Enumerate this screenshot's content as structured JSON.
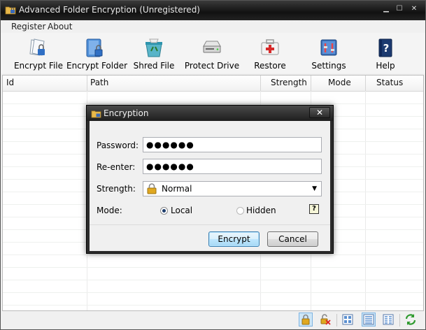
{
  "window": {
    "title": "Advanced Folder Encryption (Unregistered)",
    "controls": [
      "minimize-icon",
      "maximize-icon",
      "close-icon"
    ]
  },
  "menu": {
    "items": [
      {
        "label": "Register"
      },
      {
        "label": "About"
      }
    ]
  },
  "toolbar": {
    "items": [
      {
        "label": "Encrypt File",
        "icon": "encrypt-file-icon"
      },
      {
        "label": "Encrypt Folder",
        "icon": "encrypt-folder-icon"
      },
      {
        "label": "Shred File",
        "icon": "shred-icon"
      },
      {
        "label": "Protect Drive",
        "icon": "drive-icon"
      },
      {
        "label": "Restore",
        "icon": "restore-icon"
      },
      {
        "label": "Settings",
        "icon": "settings-icon"
      },
      {
        "label": "Help",
        "icon": "help-book-icon"
      }
    ]
  },
  "table": {
    "columns": [
      "Id",
      "Path",
      "Strength",
      "Mode",
      "Status"
    ],
    "rows": []
  },
  "dialog": {
    "title": "Encryption",
    "password_label": "Password:",
    "password_value": "●●●●●●",
    "reenter_label": "Re-enter:",
    "reenter_value": "●●●●●●",
    "strength_label": "Strength:",
    "strength_value": "Normal",
    "mode_label": "Mode:",
    "mode_options": [
      {
        "label": "Local",
        "selected": true
      },
      {
        "label": "Hidden",
        "selected": false
      }
    ],
    "help_glyph": "?",
    "encrypt_label": "Encrypt",
    "cancel_label": "Cancel"
  },
  "statusbar": {
    "icons": [
      "lock-icon",
      "unlock-icon",
      "large-icons-view-icon",
      "details-view-icon",
      "list-view-icon",
      "refresh-icon"
    ],
    "active_view": "details-view-icon"
  },
  "colors": {
    "titlebar": "#1e1e1e",
    "accent": "#3c7fb1",
    "dialog_frame": "#2b2b2b"
  }
}
